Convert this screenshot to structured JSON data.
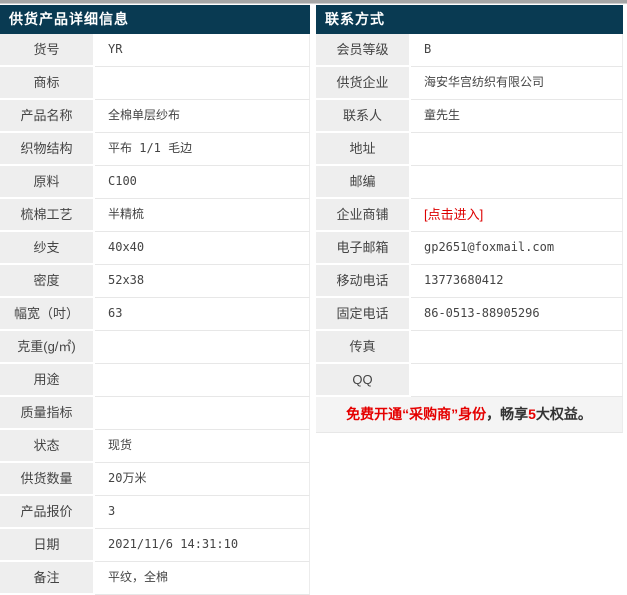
{
  "page": {
    "accent_color": "#093a52",
    "link_red": "#dd0000",
    "label_bg": "#eeeeee"
  },
  "left_table": {
    "title": "供货产品详细信息",
    "rows": [
      {
        "label": "货号",
        "value": "YR"
      },
      {
        "label": "商标",
        "value": ""
      },
      {
        "label": "产品名称",
        "value": "全棉单层纱布"
      },
      {
        "label": "织物结构",
        "value": "平布 1/1 毛边"
      },
      {
        "label": "原料",
        "value": "C100"
      },
      {
        "label": "梳棉工艺",
        "value": "半精梳"
      },
      {
        "label": "纱支",
        "value": "40x40"
      },
      {
        "label": "密度",
        "value": "52x38"
      },
      {
        "label": "幅宽（吋）",
        "value": "63"
      },
      {
        "label": "克重(g/㎡)",
        "value": ""
      },
      {
        "label": "用途",
        "value": ""
      },
      {
        "label": "质量指标",
        "value": ""
      },
      {
        "label": "状态",
        "value": "现货"
      },
      {
        "label": "供货数量",
        "value": "20万米"
      },
      {
        "label": "产品报价",
        "value": "3"
      },
      {
        "label": "日期",
        "value": "2021/11/6 14:31:10"
      },
      {
        "label": "备注",
        "value": "平纹，全棉"
      }
    ]
  },
  "right_table": {
    "title": "联系方式",
    "rows": [
      {
        "label": "会员等级",
        "value": "B"
      },
      {
        "label": "供货企业",
        "value": "海安华宫纺织有限公司"
      },
      {
        "label": "联系人",
        "value": "童先生"
      },
      {
        "label": "地址",
        "value": ""
      },
      {
        "label": "邮编",
        "value": ""
      },
      {
        "label": "企业商铺",
        "value": "[点击进入]"
      },
      {
        "label": "电子邮箱",
        "value": "gp2651@foxmail.com"
      },
      {
        "label": "移动电话",
        "value": "13773680412"
      },
      {
        "label": "固定电话",
        "value": "86-0513-88905296"
      },
      {
        "label": "传真",
        "value": ""
      },
      {
        "label": "QQ",
        "value": ""
      }
    ],
    "promo": {
      "red_link": "免费开通“采购商”身份",
      "mid": "，畅享",
      "red_num": "5",
      "tail": "大权益。"
    }
  }
}
